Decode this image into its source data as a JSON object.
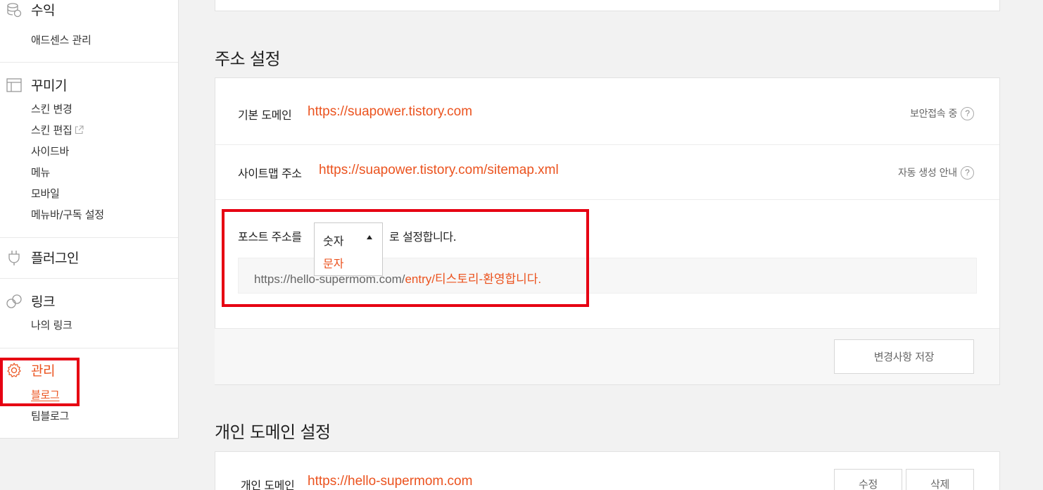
{
  "sidebar": {
    "revenue": {
      "title": "수익",
      "items": [
        "애드센스 관리"
      ]
    },
    "decorate": {
      "title": "꾸미기",
      "items": [
        "스킨 변경",
        "스킨 편집",
        "사이드바",
        "메뉴",
        "모바일",
        "메뉴바/구독 설정"
      ]
    },
    "plugin": {
      "title": "플러그인"
    },
    "link": {
      "title": "링크",
      "items": [
        "나의 링크"
      ]
    },
    "manage": {
      "title": "관리",
      "items": [
        "블로그",
        "팀블로그"
      ]
    }
  },
  "address": {
    "heading": "주소 설정",
    "default_domain_label": "기본 도메인",
    "default_domain_value": "https://suapower.tistory.com",
    "secure_note": "보안접속 중",
    "sitemap_label": "사이트맵 주소",
    "sitemap_value": "https://suapower.tistory.com/sitemap.xml",
    "sitemap_note": "자동 생성 안내",
    "post_prefix": "포스트 주소를",
    "post_suffix": "로 설정합니다.",
    "select_options": [
      "숫자",
      "문자"
    ],
    "preview_base": "https://hello-supermom.com/",
    "preview_path": "entry/티스토리-환영합니다.",
    "save_button": "변경사항 저장"
  },
  "custom_domain": {
    "heading": "개인 도메인 설정",
    "label": "개인 도메인",
    "value": "https://hello-supermom.com",
    "edit_button": "수정",
    "delete_button": "삭제"
  },
  "colors": {
    "accent": "#eb531f",
    "highlight_box": "#e60012"
  }
}
